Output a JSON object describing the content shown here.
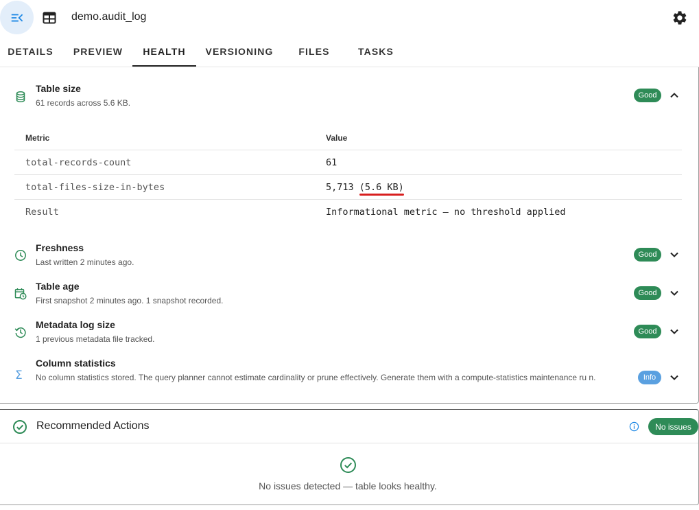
{
  "header": {
    "title": "demo.audit_log",
    "menu_icon": "menu-collapse-icon",
    "table_icon": "table-icon",
    "settings_icon": "gear-icon"
  },
  "tabs": [
    {
      "label": "DETAILS"
    },
    {
      "label": "PREVIEW"
    },
    {
      "label": "HEALTH",
      "active": true
    },
    {
      "label": "VERSIONING"
    },
    {
      "label": "FILES"
    },
    {
      "label": "TASKS"
    }
  ],
  "health": {
    "table_size": {
      "title": "Table size",
      "subtitle": "61 records across 5.6 KB.",
      "status": "Good",
      "icon": "database-icon",
      "expanded": true,
      "table": {
        "headers": [
          "Metric",
          "Value"
        ],
        "rows": [
          {
            "metric": "total-records-count",
            "value": "61"
          },
          {
            "metric": "total-files-size-in-bytes",
            "value_main": "5,713 ",
            "value_highlight": "(5.6 KB)"
          },
          {
            "metric": "Result",
            "value": "Informational metric — no threshold applied"
          }
        ]
      }
    },
    "freshness": {
      "title": "Freshness",
      "subtitle": "Last written 2 minutes ago.",
      "status": "Good",
      "icon": "clock-icon"
    },
    "table_age": {
      "title": "Table age",
      "subtitle": "First snapshot 2 minutes ago. 1 snapshot recorded.",
      "status": "Good",
      "icon": "calendar-clock-icon"
    },
    "metadata_log": {
      "title": "Metadata log size",
      "subtitle": "1 previous metadata file tracked.",
      "status": "Good",
      "icon": "history-icon"
    },
    "column_stats": {
      "title": "Column statistics",
      "subtitle": "No column statistics stored. The query planner cannot estimate cardinality or prune effectively. Generate them with a compute-statistics maintenance ru n.",
      "status": "Info",
      "icon": "sigma-icon"
    }
  },
  "recommended": {
    "title": "Recommended Actions",
    "badge": "No issues",
    "message": "No issues detected — table looks healthy.",
    "colors": {
      "good": "#2e8b57",
      "info": "#5aa0e0",
      "accent": "#1e88e5"
    }
  }
}
